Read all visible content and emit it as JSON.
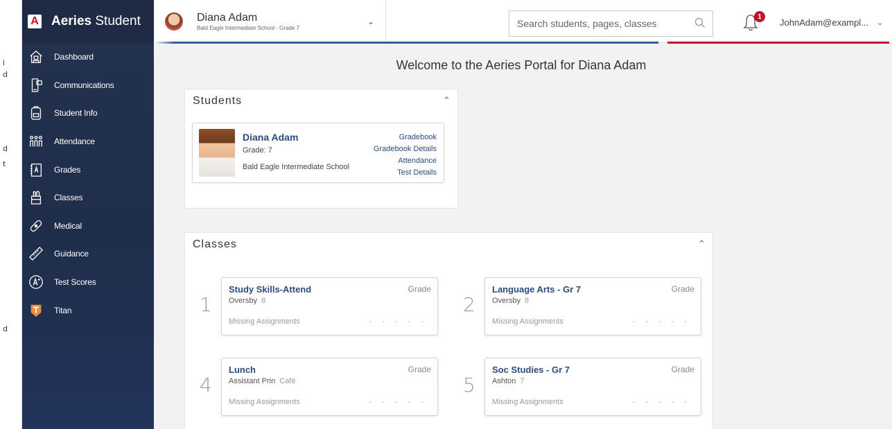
{
  "app": {
    "brand_bold": "Aeries",
    "brand_light": " Student"
  },
  "left_strip": [
    "i",
    "d",
    "d",
    "t",
    "d"
  ],
  "sidebar": {
    "items": [
      {
        "label": "Dashboard",
        "icon": "home-icon"
      },
      {
        "label": "Communications",
        "icon": "phone-chat-icon"
      },
      {
        "label": "Student Info",
        "icon": "backpack-icon"
      },
      {
        "label": "Attendance",
        "icon": "people-icon"
      },
      {
        "label": "Grades",
        "icon": "grade-report-icon"
      },
      {
        "label": "Classes",
        "icon": "pencil-cup-icon"
      },
      {
        "label": "Medical",
        "icon": "bandage-icon"
      },
      {
        "label": "Guidance",
        "icon": "ruler-icon"
      },
      {
        "label": "Test Scores",
        "icon": "a-plus-icon"
      },
      {
        "label": "Titan",
        "icon": "titan-shield-icon"
      }
    ]
  },
  "header": {
    "student_name": "Diana Adam",
    "student_school": "Bald Eagle Intermediate School - Grade 7",
    "search_placeholder": "Search students, pages, classes",
    "notification_count": "1",
    "user_email": "JohnAdam@exampl..."
  },
  "welcome": "Welcome to the Aeries Portal for Diana Adam",
  "students_panel": {
    "title": "Students",
    "card": {
      "name": "Diana Adam",
      "grade": "Grade: 7",
      "school": "Bald Eagle Intermediate School",
      "links": [
        "Gradebook",
        "Gradebook Details",
        "Attendance",
        "Test Details"
      ]
    }
  },
  "classes_panel": {
    "title": "Classes",
    "grade_label": "Grade",
    "missing_label": "Missing Assignments",
    "dashes": "- - - - -",
    "classes": [
      {
        "period": "1",
        "name": "Study Skills-Attend",
        "teacher": "Oversby",
        "room": "8"
      },
      {
        "period": "2",
        "name": "Language Arts - Gr 7",
        "teacher": "Oversby",
        "room": "8"
      },
      {
        "period": "4",
        "name": "Lunch",
        "teacher": "Assistant Prin",
        "room": "Café"
      },
      {
        "period": "5",
        "name": "Soc Studies - Gr 7",
        "teacher": "Ashton",
        "room": "7"
      }
    ]
  },
  "colors": {
    "sidebar_bg": "#24324f",
    "link_blue": "#2b4b80",
    "accent_red": "#c8102e",
    "accent_blue": "#3c5a99"
  }
}
